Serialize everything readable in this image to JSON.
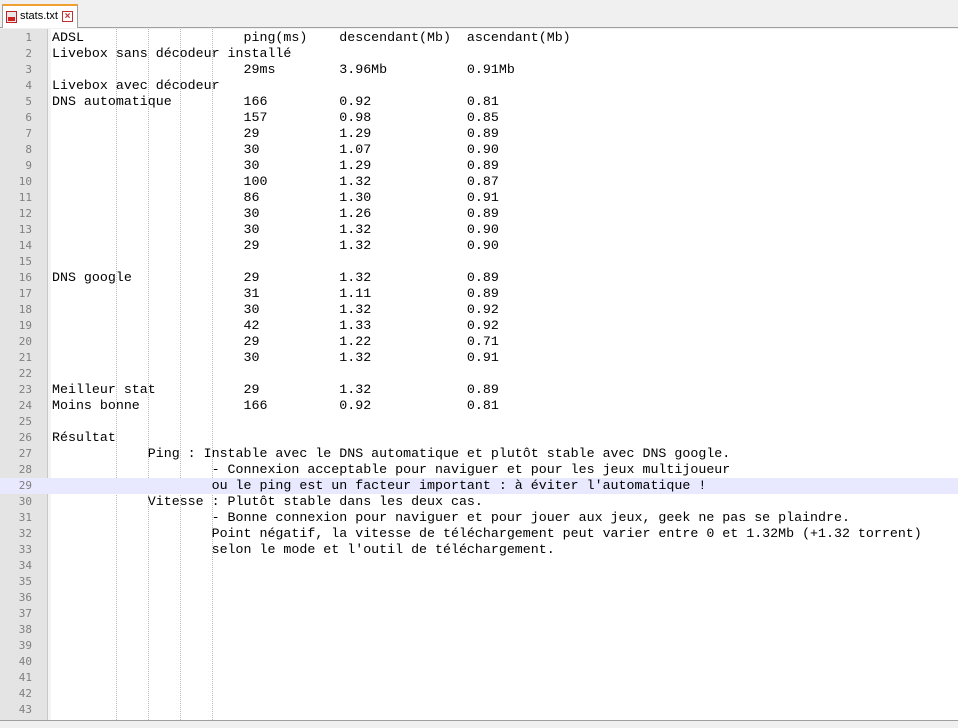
{
  "tab": {
    "filename": "stats.txt",
    "close_glyph": "×",
    "icon": "file-modified-icon"
  },
  "lines": [
    {
      "n": "1",
      "t": "ADSL                    ping(ms)    descendant(Mb)  ascendant(Mb)"
    },
    {
      "n": "2",
      "t": "Livebox sans décodeur installé"
    },
    {
      "n": "3",
      "t": "                        29ms        3.96Mb          0.91Mb"
    },
    {
      "n": "4",
      "t": "Livebox avec décodeur"
    },
    {
      "n": "5",
      "t": "DNS automatique         166         0.92            0.81"
    },
    {
      "n": "6",
      "t": "                        157         0.98            0.85"
    },
    {
      "n": "7",
      "t": "                        29          1.29            0.89"
    },
    {
      "n": "8",
      "t": "                        30          1.07            0.90"
    },
    {
      "n": "9",
      "t": "                        30          1.29            0.89"
    },
    {
      "n": "10",
      "t": "                        100         1.32            0.87"
    },
    {
      "n": "11",
      "t": "                        86          1.30            0.91"
    },
    {
      "n": "12",
      "t": "                        30          1.26            0.89"
    },
    {
      "n": "13",
      "t": "                        30          1.32            0.90"
    },
    {
      "n": "14",
      "t": "                        29          1.32            0.90"
    },
    {
      "n": "15",
      "t": ""
    },
    {
      "n": "16",
      "t": "DNS google              29          1.32            0.89"
    },
    {
      "n": "17",
      "t": "                        31          1.11            0.89"
    },
    {
      "n": "18",
      "t": "                        30          1.32            0.92"
    },
    {
      "n": "19",
      "t": "                        42          1.33            0.92"
    },
    {
      "n": "20",
      "t": "                        29          1.22            0.71"
    },
    {
      "n": "21",
      "t": "                        30          1.32            0.91"
    },
    {
      "n": "22",
      "t": ""
    },
    {
      "n": "23",
      "t": "Meilleur stat           29          1.32            0.89"
    },
    {
      "n": "24",
      "t": "Moins bonne             166         0.92            0.81"
    },
    {
      "n": "25",
      "t": ""
    },
    {
      "n": "26",
      "t": "Résultat"
    },
    {
      "n": "27",
      "t": "            Ping : Instable avec le DNS automatique et plutôt stable avec DNS google."
    },
    {
      "n": "28",
      "t": "                    - Connexion acceptable pour naviguer et pour les jeux multijoueur"
    },
    {
      "n": "29",
      "t": "                    ou le ping est un facteur important : à éviter l'automatique !"
    },
    {
      "n": "30",
      "t": "            Vitesse : Plutôt stable dans les deux cas."
    },
    {
      "n": "31",
      "t": "                    - Bonne connexion pour naviguer et pour jouer aux jeux, geek ne pas se plaindre."
    },
    {
      "n": "32",
      "t": "                    Point négatif, la vitesse de téléchargement peut varier entre 0 et 1.32Mb (+1.32 torrent)"
    },
    {
      "n": "33",
      "t": "                    selon le mode et l'outil de téléchargement."
    },
    {
      "n": "34",
      "t": ""
    },
    {
      "n": "35",
      "t": ""
    },
    {
      "n": "36",
      "t": ""
    },
    {
      "n": "37",
      "t": ""
    },
    {
      "n": "38",
      "t": ""
    },
    {
      "n": "39",
      "t": ""
    },
    {
      "n": "40",
      "t": ""
    },
    {
      "n": "41",
      "t": ""
    },
    {
      "n": "42",
      "t": ""
    },
    {
      "n": "43",
      "t": ""
    }
  ],
  "current_line": "29"
}
